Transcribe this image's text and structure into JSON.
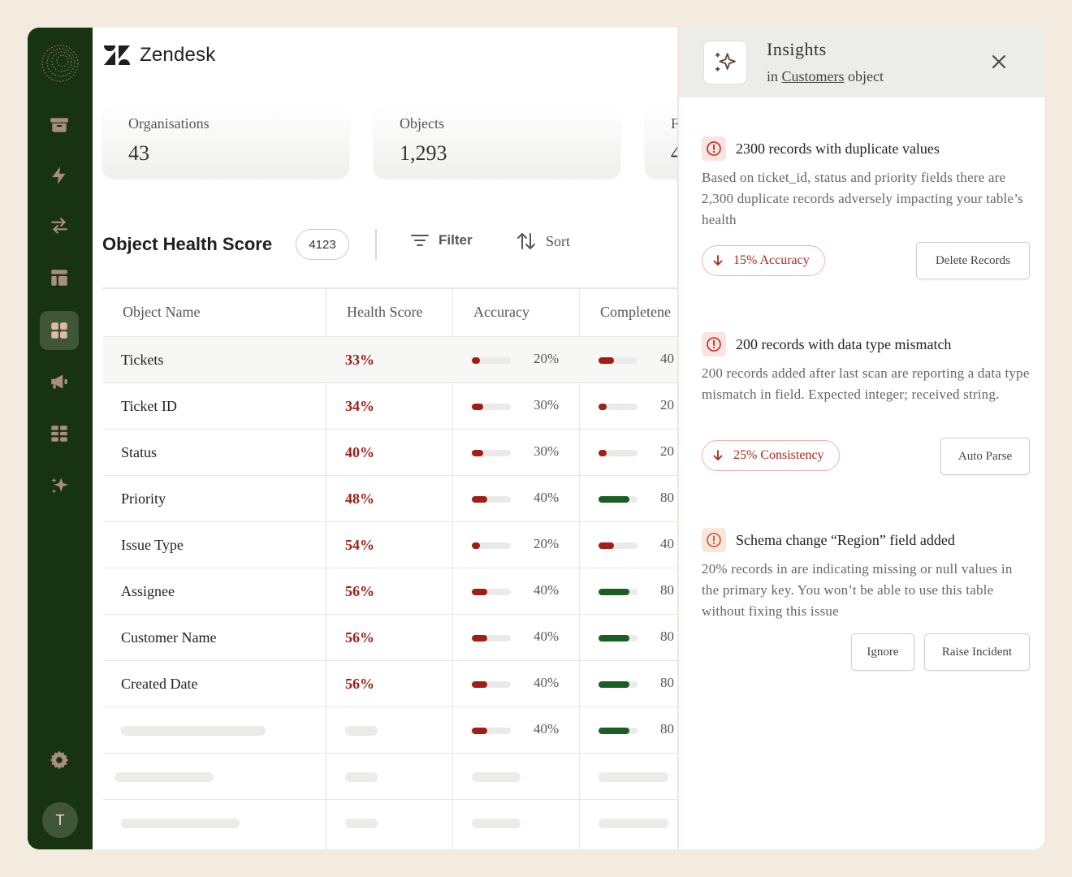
{
  "brand": {
    "name": "Zendesk"
  },
  "sidebar": {
    "items": [
      {
        "name": "archive-icon"
      },
      {
        "name": "lightning-icon"
      },
      {
        "name": "transfer-icon"
      },
      {
        "name": "layout-icon"
      },
      {
        "name": "dashboard-grid-icon",
        "active": true
      },
      {
        "name": "megaphone-icon"
      },
      {
        "name": "table-grid-icon"
      },
      {
        "name": "sparkle-icon"
      }
    ],
    "settings_icon": "gear-icon",
    "avatar_initial": "T"
  },
  "stats": [
    {
      "label": "Organisations",
      "value": "43"
    },
    {
      "label": "Objects",
      "value": "1,293"
    },
    {
      "label": "F",
      "value": "4"
    }
  ],
  "section": {
    "title": "Object Health Score",
    "count": "4123",
    "filter_label": "Filter",
    "sort_label": "Sort"
  },
  "table": {
    "columns": [
      "Object Name",
      "Health Score",
      "Accuracy",
      "Completene"
    ],
    "rows": [
      {
        "name": "Tickets",
        "score": "33%",
        "accuracy": 0.2,
        "accuracy_label": "20%",
        "completeness": 0.4,
        "completeness_label": "40",
        "completeness_color": "#a21d16",
        "highlight": true
      },
      {
        "name": "Ticket ID",
        "score": "34%",
        "accuracy": 0.3,
        "accuracy_label": "30%",
        "completeness": 0.2,
        "completeness_label": "20",
        "completeness_color": "#a21d16"
      },
      {
        "name": "Status",
        "score": "40%",
        "accuracy": 0.3,
        "accuracy_label": "30%",
        "completeness": 0.2,
        "completeness_label": "20",
        "completeness_color": "#a21d16"
      },
      {
        "name": "Priority",
        "score": "48%",
        "accuracy": 0.4,
        "accuracy_label": "40%",
        "completeness": 0.8,
        "completeness_label": "80",
        "completeness_color": "#1c5e22"
      },
      {
        "name": "Issue Type",
        "score": "54%",
        "accuracy": 0.2,
        "accuracy_label": "20%",
        "completeness": 0.4,
        "completeness_label": "40",
        "completeness_color": "#a21d16"
      },
      {
        "name": "Assignee",
        "score": "56%",
        "accuracy": 0.4,
        "accuracy_label": "40%",
        "completeness": 0.8,
        "completeness_label": "80",
        "completeness_color": "#1c5e22"
      },
      {
        "name": "Customer Name",
        "score": "56%",
        "accuracy": 0.4,
        "accuracy_label": "40%",
        "completeness": 0.8,
        "completeness_label": "80",
        "completeness_color": "#1c5e22"
      },
      {
        "name": "Created Date",
        "score": "56%",
        "accuracy": 0.4,
        "accuracy_label": "40%",
        "completeness": 0.8,
        "completeness_label": "80",
        "completeness_color": "#1c5e22"
      },
      {
        "name": "",
        "score": "",
        "accuracy": 0.4,
        "accuracy_label": "40%",
        "completeness": 0.8,
        "completeness_label": "80",
        "completeness_color": "#1c5e22",
        "skeleton": true
      }
    ]
  },
  "insights": {
    "title": "Insights",
    "subtitle_prefix": "in",
    "subtitle_link": "Customers",
    "subtitle_suffix": "object",
    "items": [
      {
        "title": "2300 records with duplicate values",
        "description": "Based on ticket_id, status and priority fields there are 2,300 duplicate records adversely impacting your table’s health",
        "badge": "15% Accuracy",
        "actions": [
          "Delete Records"
        ]
      },
      {
        "title": "200 records with data type mismatch",
        "description": "200 records added after last scan are reporting a data type mismatch in field. Expected integer; received string.",
        "badge": "25% Consistency",
        "actions": [
          "Auto Parse"
        ]
      },
      {
        "title": "Schema change “Region” field added",
        "description": "20% records in are indicating missing or null values in the primary key. You won’t be able to use this table without fixing this issue",
        "actions": [
          "Ignore",
          "Raise Incident"
        ]
      }
    ]
  },
  "colors": {
    "sidebar_bg": "#183312",
    "accent_red": "#a21d16",
    "accent_green": "#1c5e22",
    "page_bg": "#f3ebe0"
  }
}
